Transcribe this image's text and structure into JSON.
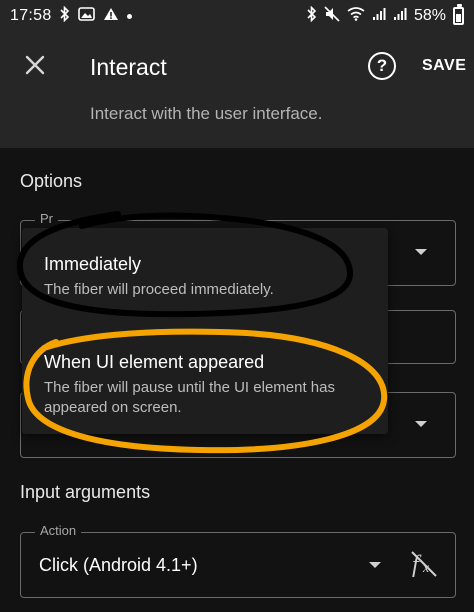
{
  "status_bar": {
    "time": "17:58",
    "battery": "58%"
  },
  "toolbar": {
    "title": "Interact",
    "save_label": "SAVE",
    "help_glyph": "?"
  },
  "subtitle": "Interact with the user interface.",
  "options": {
    "section_title": "Options",
    "first_field_label": "Pr",
    "second_field_label": "",
    "third_field_label": ""
  },
  "menu": {
    "items": [
      {
        "title": "Immediately",
        "description": "The fiber will proceed immediately."
      },
      {
        "title": "When UI element appeared",
        "description": "The fiber will pause until the UI element has appeared on screen."
      }
    ]
  },
  "input_arguments": {
    "section_title": "Input arguments",
    "action_label": "Action",
    "action_value": "Click (Android 4.1+)"
  },
  "icons": {
    "close": "close-icon",
    "help": "help-circle-icon",
    "dropdown": "chevron-down-icon",
    "formula": "function-off-icon"
  },
  "colors": {
    "header_bg": "#262626",
    "body_bg": "#121212",
    "menu_bg": "#1e1e1e",
    "annotation_black": "#000000",
    "annotation_orange": "#f5a300"
  }
}
